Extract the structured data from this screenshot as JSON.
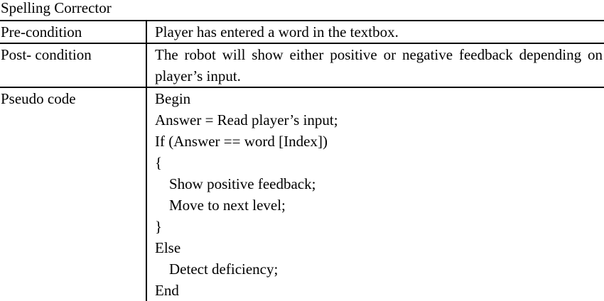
{
  "caption": "Spelling Corrector",
  "rows": [
    {
      "label": "Pre-condition",
      "value": "Player has entered a word in the textbox."
    },
    {
      "label": "Post- condition",
      "value": "The robot will show either positive or negative feedback depending on player’s input."
    },
    {
      "label": "Pseudo code",
      "code": [
        "Begin",
        "Answer = Read player’s input;",
        "If (Answer == word [Index])",
        "{",
        "Show positive feedback;",
        "Move to next level;",
        "}",
        "Else",
        "Detect deficiency;",
        "End"
      ]
    }
  ]
}
